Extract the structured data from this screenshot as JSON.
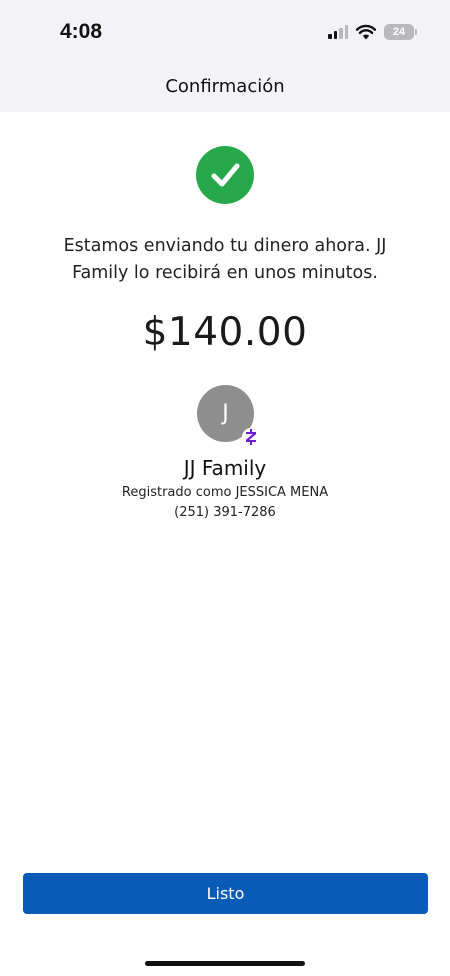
{
  "status_bar": {
    "time": "4:08",
    "battery": "24",
    "icons": [
      "cellular-signal-icon",
      "wifi-icon",
      "battery-icon"
    ]
  },
  "header": {
    "title": "Confirmación"
  },
  "confirmation": {
    "icon": "check-circle-icon",
    "message": "Estamos enviando tu dinero ahora. JJ Family lo recibirá en unos minutos.",
    "amount": "$140.00"
  },
  "recipient": {
    "initial": "J",
    "badge_icon": "zelle-icon",
    "name": "JJ Family",
    "registered_as": "Registrado como JESSICA MENA",
    "phone": "(251) 391-7286"
  },
  "actions": {
    "done_label": "Listo"
  },
  "colors": {
    "accent": "#0a5ab8",
    "success": "#27a84a",
    "avatar": "#8e8e8e",
    "zelle": "#6d1ed4",
    "header_bg": "#f3f3f5"
  }
}
